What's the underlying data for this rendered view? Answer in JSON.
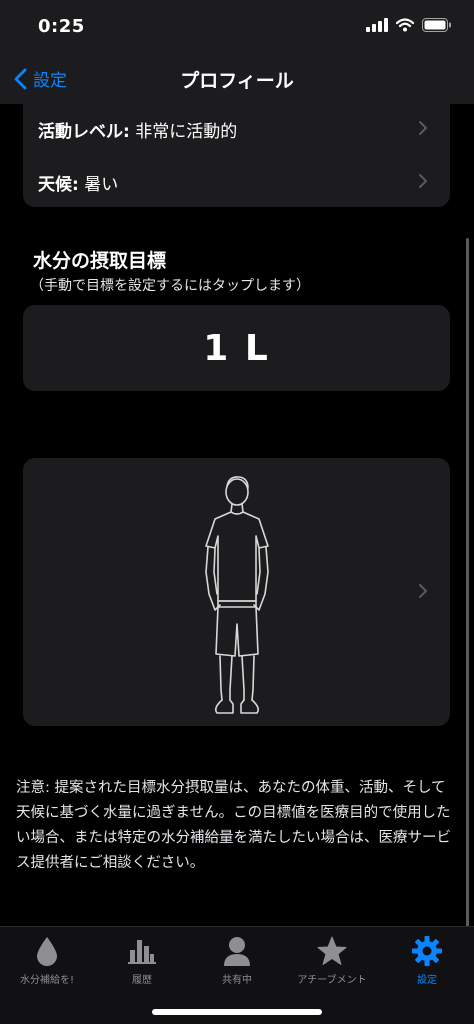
{
  "status": {
    "time": "0:25"
  },
  "nav": {
    "back_label": "設定",
    "title": "プロフィール"
  },
  "settings": [
    {
      "key": "活動レベル:",
      "value": "非常に活動的"
    },
    {
      "key": "天候:",
      "value": "暑い"
    }
  ],
  "goal": {
    "title": "水分の摂取目標",
    "subtitle": "（手動で目標を設定するにはタップします）",
    "value": "1 L"
  },
  "disclaimer": "注意: 提案された目標水分摂取量は、あなたの体重、活動、そして天候に基づく水量に過ぎません。この目標値を医療目的で使用したい場合、または特定の水分補給量を満たしたい場合は、医療サービス提供者にご相談ください。",
  "tabs": [
    {
      "label": "水分補給を!",
      "icon": "water-drop-icon",
      "active": false
    },
    {
      "label": "履歴",
      "icon": "bar-chart-icon",
      "active": false
    },
    {
      "label": "共有中",
      "icon": "person-icon",
      "active": false
    },
    {
      "label": "アチーブメント",
      "icon": "star-icon",
      "active": false
    },
    {
      "label": "設定",
      "icon": "gear-icon",
      "active": true
    }
  ],
  "colors": {
    "accent": "#0a84ff",
    "card": "#1c1c1e",
    "background": "#000000"
  }
}
